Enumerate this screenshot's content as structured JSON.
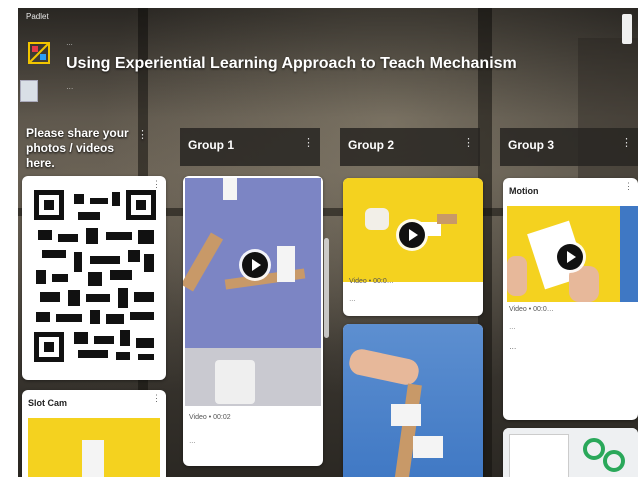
{
  "padlet_tag": "Padlet",
  "header": {
    "author": "…",
    "title": "Using Experiential Learning Approach to Teach Mechanism",
    "subtitle": "…"
  },
  "columns": [
    {
      "title": "Please share your photos / videos here."
    },
    {
      "title": "Group 1"
    },
    {
      "title": "Group 2"
    },
    {
      "title": "Group 3"
    }
  ],
  "cards": {
    "qr": {
      "label": ""
    },
    "slot_cam": {
      "title": "Slot Cam"
    },
    "group1_video": {
      "type": "Video • 00:02",
      "date": "…"
    },
    "group2_video": {
      "type": "Video • 00:0…",
      "date": "…"
    },
    "group3_post": {
      "title": "Motion",
      "type": "Video • 00:0…",
      "date": "…",
      "body": "…"
    }
  },
  "colors": {
    "yellow": "#f4d21f",
    "blue_bg": "#7c85c4",
    "card_bg": "#ffffff"
  },
  "icons": [
    "padlet-logo-icon",
    "more-dots-icon",
    "play-icon",
    "qr-code-icon"
  ]
}
